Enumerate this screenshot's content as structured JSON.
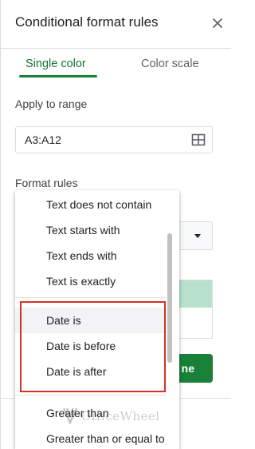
{
  "panel": {
    "title": "Conditional format rules",
    "tabs": [
      {
        "label": "Single color",
        "active": true
      },
      {
        "label": "Color scale",
        "active": false
      }
    ],
    "apply_label": "Apply to range",
    "range_value": "A3:A12",
    "rules_label": "Format rules",
    "done_label": "Done",
    "done_visible_label": "ne"
  },
  "dropdown": {
    "items": [
      {
        "label": "Text does not contain"
      },
      {
        "label": "Text starts with"
      },
      {
        "label": "Text ends with"
      },
      {
        "label": "Text is exactly"
      },
      {
        "label": "Date is",
        "highlighted": true
      },
      {
        "label": "Date is before"
      },
      {
        "label": "Date is after"
      },
      {
        "label": "Greater than"
      },
      {
        "label": "Greater than or equal to"
      }
    ]
  },
  "watermark": {
    "text": "OfficeWheel"
  },
  "colors": {
    "accent_green": "#188038",
    "tab_text_green": "#137333",
    "preview_fill": "#b7e1cd",
    "annotation_red": "#d93025"
  },
  "icons": [
    "close-icon",
    "grid-icon",
    "dropdown-caret-icon",
    "officewheel-logo-icon"
  ]
}
